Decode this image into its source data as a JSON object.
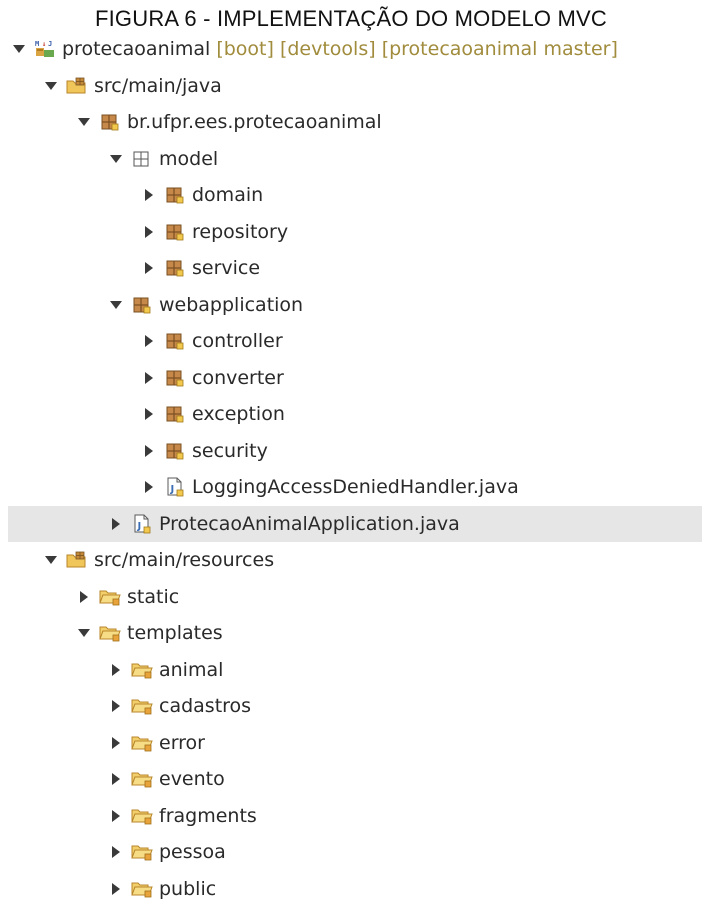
{
  "caption": "FIGURA 6 - IMPLEMENTAÇÃO DO MODELO MVC",
  "tree": {
    "project": {
      "label": "protecaoanimal",
      "decorations": "[boot] [devtools] [protecaoanimal master]",
      "icon": "maven-project-icon"
    },
    "src_main_java": "src/main/java",
    "root_package": "br.ufpr.ees.protecaoanimal",
    "model": "model",
    "domain": "domain",
    "repository": "repository",
    "service": "service",
    "webapplication": "webapplication",
    "controller": "controller",
    "converter": "converter",
    "exception": "exception",
    "security": "security",
    "logging_handler": "LoggingAccessDeniedHandler.java",
    "application": "ProtecaoAnimalApplication.java",
    "src_main_resources": "src/main/resources",
    "static": "static",
    "templates": "templates",
    "animal": "animal",
    "cadastros": "cadastros",
    "error": "error",
    "evento": "evento",
    "fragments": "fragments",
    "pessoa": "pessoa",
    "public": "public"
  },
  "colors": {
    "selection": "#e6e6e6",
    "decoration": "#a08c3c",
    "package": "#b8863a",
    "folder": "#e8b84a"
  }
}
